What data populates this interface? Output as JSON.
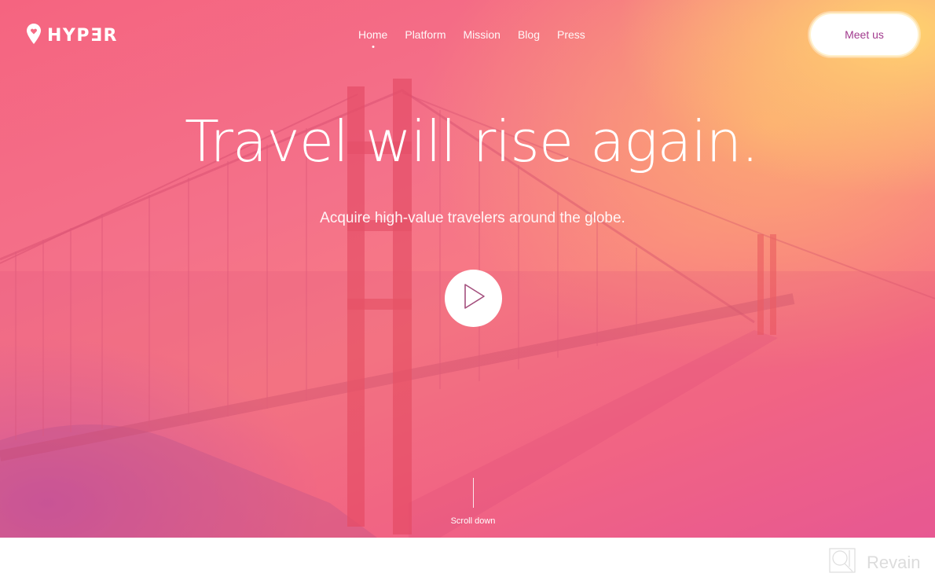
{
  "brand": {
    "name": "HYPƎR",
    "logo_icon": "map-pin-heart-icon"
  },
  "nav": {
    "items": [
      {
        "label": "Home",
        "active": true
      },
      {
        "label": "Platform",
        "active": false
      },
      {
        "label": "Mission",
        "active": false
      },
      {
        "label": "Blog",
        "active": false
      },
      {
        "label": "Press",
        "active": false
      }
    ],
    "cta_label": "Meet us"
  },
  "hero": {
    "headline": "Travel will rise again.",
    "subheadline": "Acquire high-value travelers around the globe.",
    "play_icon": "play-icon",
    "scroll_label": "Scroll down",
    "background_image": "golden-gate-bridge"
  },
  "colors": {
    "gradient_pink": "#f56480",
    "gradient_orange": "#fdb070",
    "gradient_yellow": "#ffd66e",
    "gradient_magenta": "#c450aa",
    "cta_text": "#a23b8e"
  },
  "watermark": {
    "label": "Revain",
    "icon": "revain-logo-icon"
  }
}
